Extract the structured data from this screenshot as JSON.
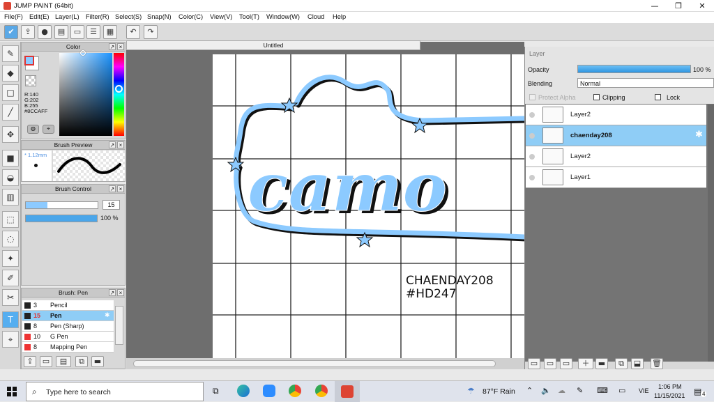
{
  "window": {
    "title": "JUMP PAINT (64bit)"
  },
  "menu": [
    "File(F)",
    "Edit(E)",
    "Layer(L)",
    "Filter(R)",
    "Select(S)",
    "Snap(N)",
    "Color(C)",
    "View(V)",
    "Tool(T)",
    "Window(W)",
    "Cloud",
    "Help"
  ],
  "color_panel": {
    "title": "Color",
    "r": "R:140",
    "g": "G:202",
    "b": "B:255",
    "hex": "#8CCAFF",
    "fg_color": "#8CCAFF",
    "bg_color": "#ffffff"
  },
  "brush_preview": {
    "title": "Brush Preview",
    "size": "1.12mm"
  },
  "brush_control": {
    "title": "Brush Control",
    "size_value": "15",
    "size_fraction": 0.3,
    "opacity_value": "100 %",
    "opacity_fraction": 1.0
  },
  "brush_list": {
    "title": "Brush: Pen",
    "items": [
      {
        "size": "3",
        "name": "Pencil",
        "color": "#222222"
      },
      {
        "size": "15",
        "name": "Pen",
        "color": "#222222",
        "selected": true
      },
      {
        "size": "8",
        "name": "Pen (Sharp)",
        "color": "#222222"
      },
      {
        "size": "10",
        "name": "G Pen",
        "color": "#ee3333"
      },
      {
        "size": "8",
        "name": "Mapping Pen",
        "color": "#ee3333"
      }
    ]
  },
  "document": {
    "tab_title": "Untitled",
    "caption_line1": "CHAENDAY208",
    "caption_line2": "#HD247",
    "artwork_text": "camo",
    "artwork_color": "#8CCAFF"
  },
  "layer_panel": {
    "title": "Layer",
    "opacity_label": "Opacity",
    "opacity_value": "100 %",
    "opacity_fraction": 1.0,
    "blending_label": "Blending",
    "blending_value": "Normal",
    "protect_alpha": "Protect Alpha",
    "clipping": "Clipping",
    "lock": "Lock",
    "layers": [
      {
        "name": "Layer2",
        "selected": false
      },
      {
        "name": "chaenday208",
        "selected": true
      },
      {
        "name": "Layer2",
        "selected": false
      },
      {
        "name": "Layer1",
        "selected": false
      }
    ]
  },
  "taskbar": {
    "search_placeholder": "Type here to search",
    "weather": "87°F Rain",
    "language": "VIE",
    "time": "1:06 PM",
    "date": "11/15/2021",
    "notifications": "4"
  },
  "icons": [
    "windows-start-icon",
    "search-icon",
    "task-view-icon",
    "edge-icon",
    "zoom-icon",
    "chrome-icon",
    "jump-paint-icon",
    "weather-icon",
    "chevron-up-icon",
    "speaker-icon",
    "network-icon",
    "keyboard-icon",
    "notification-icon"
  ]
}
